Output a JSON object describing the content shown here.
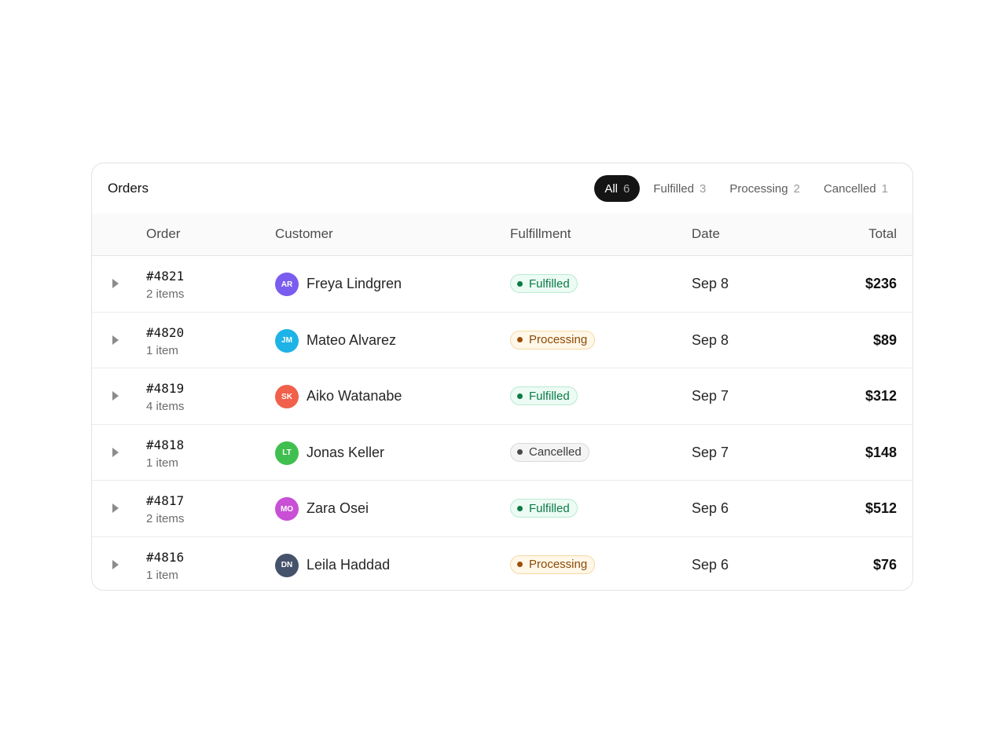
{
  "header": {
    "title": "Orders",
    "filters": [
      {
        "label": "All",
        "count": "6",
        "active": true
      },
      {
        "label": "Fulfilled",
        "count": "3",
        "active": false
      },
      {
        "label": "Processing",
        "count": "2",
        "active": false
      },
      {
        "label": "Cancelled",
        "count": "1",
        "active": false
      }
    ]
  },
  "columns": {
    "order": "Order",
    "customer": "Customer",
    "fulfillment": "Fulfillment",
    "date": "Date",
    "total": "Total"
  },
  "status_styles": {
    "Fulfilled": {
      "bg": "#ecfbf3",
      "border": "#b9ebd0",
      "text": "#0b7a46",
      "dot": "#0b7a46"
    },
    "Processing": {
      "bg": "#fff7e8",
      "border": "#f6d9a2",
      "text": "#8a4a06",
      "dot": "#9a4f08"
    },
    "Cancelled": {
      "bg": "#f4f4f4",
      "border": "#d9d9d9",
      "text": "#3d3d3d",
      "dot": "#4a4a4a"
    }
  },
  "rows": [
    {
      "order_id": "#4821",
      "items": "2 items",
      "initials": "AR",
      "avatar_color": "#7b5cf0",
      "customer": "Freya Lindgren",
      "status": "Fulfilled",
      "date": "Sep 8",
      "total": "$236"
    },
    {
      "order_id": "#4820",
      "items": "1 item",
      "initials": "JM",
      "avatar_color": "#1eb3e6",
      "customer": "Mateo Alvarez",
      "status": "Processing",
      "date": "Sep 8",
      "total": "$89"
    },
    {
      "order_id": "#4819",
      "items": "4 items",
      "initials": "SK",
      "avatar_color": "#f0604a",
      "customer": "Aiko Watanabe",
      "status": "Fulfilled",
      "date": "Sep 7",
      "total": "$312"
    },
    {
      "order_id": "#4818",
      "items": "1 item",
      "initials": "LT",
      "avatar_color": "#3fbf4f",
      "customer": "Jonas Keller",
      "status": "Cancelled",
      "date": "Sep 7",
      "total": "$148"
    },
    {
      "order_id": "#4817",
      "items": "2 items",
      "initials": "MO",
      "avatar_color": "#c84fd6",
      "customer": "Zara Osei",
      "status": "Fulfilled",
      "date": "Sep 6",
      "total": "$512"
    },
    {
      "order_id": "#4816",
      "items": "1 item",
      "initials": "DN",
      "avatar_color": "#45526b",
      "customer": "Leila Haddad",
      "status": "Processing",
      "date": "Sep 6",
      "total": "$76"
    }
  ]
}
